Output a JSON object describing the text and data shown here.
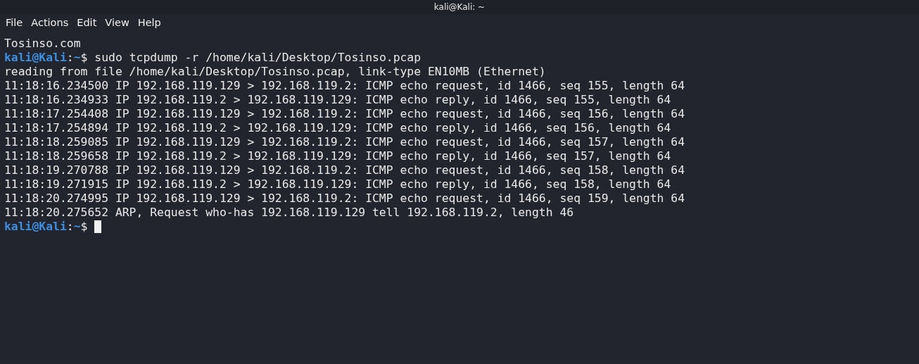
{
  "window": {
    "title": "kali@Kali: ~"
  },
  "menu": [
    "File",
    "Actions",
    "Edit",
    "View",
    "Help"
  ],
  "terminal": {
    "lines": [
      {
        "kind": "text",
        "text": "Tosinso.com"
      },
      {
        "kind": "prompt",
        "user": "kali@Kali",
        "separator": ":",
        "path": "~",
        "symbol": "$",
        "command": "sudo tcpdump -r /home/kali/Desktop/Tosinso.pcap",
        "cursor": false
      },
      {
        "kind": "text",
        "text": "reading from file /home/kali/Desktop/Tosinso.pcap, link-type EN10MB (Ethernet)"
      },
      {
        "kind": "text",
        "text": "11:18:16.234500 IP 192.168.119.129 > 192.168.119.2: ICMP echo request, id 1466, seq 155, length 64"
      },
      {
        "kind": "text",
        "text": "11:18:16.234933 IP 192.168.119.2 > 192.168.119.129: ICMP echo reply, id 1466, seq 155, length 64"
      },
      {
        "kind": "text",
        "text": "11:18:17.254408 IP 192.168.119.129 > 192.168.119.2: ICMP echo request, id 1466, seq 156, length 64"
      },
      {
        "kind": "text",
        "text": "11:18:17.254894 IP 192.168.119.2 > 192.168.119.129: ICMP echo reply, id 1466, seq 156, length 64"
      },
      {
        "kind": "text",
        "text": "11:18:18.259085 IP 192.168.119.129 > 192.168.119.2: ICMP echo request, id 1466, seq 157, length 64"
      },
      {
        "kind": "text",
        "text": "11:18:18.259658 IP 192.168.119.2 > 192.168.119.129: ICMP echo reply, id 1466, seq 157, length 64"
      },
      {
        "kind": "text",
        "text": "11:18:19.270788 IP 192.168.119.129 > 192.168.119.2: ICMP echo request, id 1466, seq 158, length 64"
      },
      {
        "kind": "text",
        "text": "11:18:19.271915 IP 192.168.119.2 > 192.168.119.129: ICMP echo reply, id 1466, seq 158, length 64"
      },
      {
        "kind": "text",
        "text": "11:18:20.274995 IP 192.168.119.129 > 192.168.119.2: ICMP echo request, id 1466, seq 159, length 64"
      },
      {
        "kind": "text",
        "text": "11:18:20.275652 ARP, Request who-has 192.168.119.129 tell 192.168.119.2, length 46"
      },
      {
        "kind": "prompt",
        "user": "kali@Kali",
        "separator": ":",
        "path": "~",
        "symbol": "$",
        "cursor": true
      }
    ]
  }
}
